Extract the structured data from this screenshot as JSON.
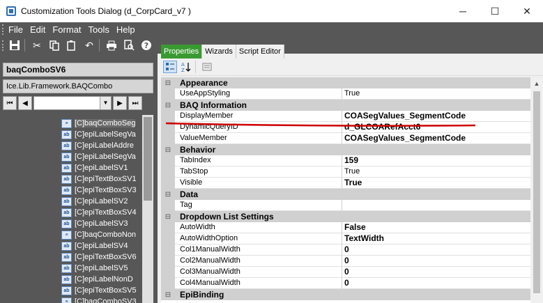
{
  "window": {
    "title": "Customization Tools Dialog  (d_CorpCard_v7 )",
    "minimize": "─",
    "maximize": "☐",
    "close": "✕"
  },
  "menu": [
    "File",
    "Edit",
    "Format",
    "Tools",
    "Help"
  ],
  "toolbar_icons": [
    "save-icon",
    "cut-icon",
    "copy-icon",
    "paste-icon",
    "undo-icon",
    "print-icon",
    "print-preview-icon",
    "help-icon"
  ],
  "tabs": [
    "Properties",
    "Wizards",
    "Script Editor"
  ],
  "left": {
    "control_name": "baqComboSV6",
    "control_type": "Ice.Lib.Framework.BAQCombo",
    "nav": {
      "first": "⏮",
      "prev": "◀",
      "next": "▶",
      "last": "⏭",
      "dropdown": "▼"
    },
    "tree_items": [
      {
        "icon": "combo",
        "label": "[C]baqComboSeg"
      },
      {
        "icon": "ab",
        "label": "[C]epiLabelSegVa"
      },
      {
        "icon": "ab",
        "label": "[C]epiLabelAddre"
      },
      {
        "icon": "ab",
        "label": "[C]epiLabelSegVa"
      },
      {
        "icon": "ab",
        "label": "[C]epiLabelSV1"
      },
      {
        "icon": "ab",
        "label": "[C]epiTextBoxSV1"
      },
      {
        "icon": "ab",
        "label": "[C]epiTextBoxSV3"
      },
      {
        "icon": "ab",
        "label": "[C]epiLabelSV2"
      },
      {
        "icon": "ab",
        "label": "[C]epiTextBoxSV4"
      },
      {
        "icon": "ab",
        "label": "[C]epiLabelSV3"
      },
      {
        "icon": "combo",
        "label": "[C]baqComboNon"
      },
      {
        "icon": "ab",
        "label": "[C]epiLabelSV4"
      },
      {
        "icon": "ab",
        "label": "[C]epiTextBoxSV6"
      },
      {
        "icon": "ab",
        "label": "[C]epiLabelSV5"
      },
      {
        "icon": "ab",
        "label": "[C]epiLabelNonD"
      },
      {
        "icon": "ab",
        "label": "[C]epiTextBoxSV5"
      },
      {
        "icon": "combo",
        "label": "[C]baqComboSV3"
      }
    ]
  },
  "grid": {
    "rows": [
      {
        "type": "cat",
        "name": "Appearance"
      },
      {
        "type": "prop",
        "name": "UseAppStyling",
        "value": "True",
        "bold": false
      },
      {
        "type": "cat",
        "name": "BAQ Information"
      },
      {
        "type": "prop",
        "name": "DisplayMember",
        "value": "COASegValues_SegmentCode",
        "bold": true
      },
      {
        "type": "prop",
        "name": "DynamicQueryID",
        "value": "d_GLCOARefAcct6",
        "bold": true
      },
      {
        "type": "prop",
        "name": "ValueMember",
        "value": "COASegValues_SegmentCode",
        "bold": true
      },
      {
        "type": "cat",
        "name": "Behavior"
      },
      {
        "type": "prop",
        "name": "TabIndex",
        "value": "159",
        "bold": true
      },
      {
        "type": "prop",
        "name": "TabStop",
        "value": "True",
        "bold": false
      },
      {
        "type": "prop",
        "name": "Visible",
        "value": "True",
        "bold": true
      },
      {
        "type": "cat",
        "name": "Data"
      },
      {
        "type": "prop",
        "name": "Tag",
        "value": "",
        "bold": false
      },
      {
        "type": "cat",
        "name": "Dropdown List Settings"
      },
      {
        "type": "prop",
        "name": "AutoWidth",
        "value": "False",
        "bold": true
      },
      {
        "type": "prop",
        "name": "AutoWidthOption",
        "value": "TextWidth",
        "bold": true
      },
      {
        "type": "prop",
        "name": "Col1ManualWidth",
        "value": "0",
        "bold": true
      },
      {
        "type": "prop",
        "name": "Col2ManualWidth",
        "value": "0",
        "bold": true
      },
      {
        "type": "prop",
        "name": "Col3ManualWidth",
        "value": "0",
        "bold": true
      },
      {
        "type": "prop",
        "name": "Col4ManualWidth",
        "value": "0",
        "bold": true
      },
      {
        "type": "cat",
        "name": "EpiBinding"
      }
    ]
  },
  "colors": {
    "active_tab": "#3a9a32",
    "dark_chrome": "#575757",
    "annotation_line": "#cc0000"
  }
}
